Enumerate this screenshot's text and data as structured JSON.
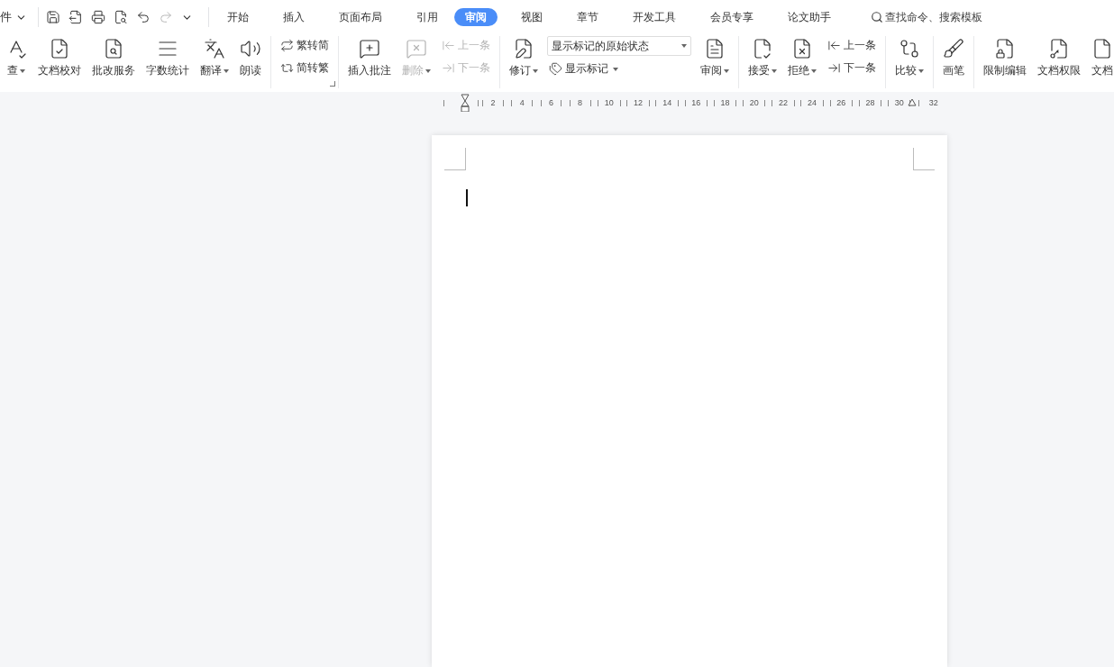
{
  "menu_bar": {
    "file_menu": "件",
    "tabs": [
      {
        "label": "开始",
        "selected": false
      },
      {
        "label": "插入",
        "selected": false
      },
      {
        "label": "页面布局",
        "selected": false
      },
      {
        "label": "引用",
        "selected": false
      },
      {
        "label": "审阅",
        "selected": true
      },
      {
        "label": "视图",
        "selected": false
      },
      {
        "label": "章节",
        "selected": false
      },
      {
        "label": "开发工具",
        "selected": false
      },
      {
        "label": "会员专享",
        "selected": false
      },
      {
        "label": "论文助手",
        "selected": false
      }
    ],
    "search": {
      "placeholder": "查找命令、搜索模板"
    }
  },
  "ribbon": [
    {
      "items": [
        {
          "kind": "large",
          "label": "查",
          "dropdown": true,
          "disabled": false
        },
        {
          "kind": "large",
          "label": "文档校对",
          "dropdown": false,
          "disabled": false
        },
        {
          "kind": "large",
          "label": "批改服务",
          "dropdown": false,
          "disabled": false
        },
        {
          "kind": "large",
          "label": "字数统计",
          "dropdown": false,
          "disabled": false
        },
        {
          "kind": "large",
          "label": "翻译",
          "dropdown": true,
          "disabled": false
        },
        {
          "kind": "large",
          "label": "朗读",
          "dropdown": false,
          "disabled": false
        }
      ]
    },
    {
      "launcher": true,
      "items": [
        {
          "kind": "stack",
          "buttons": [
            {
              "label": "繁转简",
              "dropdown": false,
              "disabled": false
            },
            {
              "label": "简转繁",
              "dropdown": false,
              "disabled": false
            }
          ]
        }
      ]
    },
    {
      "items": [
        {
          "kind": "large",
          "label": "插入批注",
          "dropdown": false,
          "disabled": false
        },
        {
          "kind": "large",
          "label": "删除",
          "dropdown": true,
          "disabled": true
        },
        {
          "kind": "stack",
          "buttons": [
            {
              "label": "上一条",
              "dropdown": false,
              "disabled": true
            },
            {
              "label": "下一条",
              "dropdown": false,
              "disabled": true
            }
          ]
        }
      ]
    },
    {
      "items": [
        {
          "kind": "large",
          "label": "修订",
          "dropdown": true,
          "disabled": false
        },
        {
          "kind": "select",
          "value": "显示标记的原始状态",
          "button": {
            "label": "显示标记",
            "dropdown": true,
            "disabled": false
          }
        },
        {
          "kind": "large",
          "label": "审阅",
          "dropdown": true,
          "disabled": false
        }
      ]
    },
    {
      "items": [
        {
          "kind": "large",
          "label": "接受",
          "dropdown": true,
          "disabled": false
        },
        {
          "kind": "large",
          "label": "拒绝",
          "dropdown": true,
          "disabled": false
        },
        {
          "kind": "stack",
          "buttons": [
            {
              "label": "上一条",
              "dropdown": false,
              "disabled": false
            },
            {
              "label": "下一条",
              "dropdown": false,
              "disabled": false
            }
          ]
        }
      ]
    },
    {
      "items": [
        {
          "kind": "large",
          "label": "比较",
          "dropdown": true,
          "disabled": false
        }
      ]
    },
    {
      "items": [
        {
          "kind": "large",
          "label": "画笔",
          "dropdown": false,
          "disabled": false
        }
      ]
    },
    {
      "items": [
        {
          "kind": "large",
          "label": "限制编辑",
          "dropdown": false,
          "disabled": false
        },
        {
          "kind": "large",
          "label": "文档权限",
          "dropdown": false,
          "disabled": false
        },
        {
          "kind": "large",
          "label": "文档",
          "dropdown": false,
          "disabled": false
        }
      ]
    }
  ],
  "ruler": {
    "labels": [
      "2",
      "4",
      "6",
      "8",
      "10",
      "12",
      "14",
      "16",
      "18",
      "20",
      "22",
      "24",
      "26",
      "28",
      "30",
      "32"
    ]
  }
}
